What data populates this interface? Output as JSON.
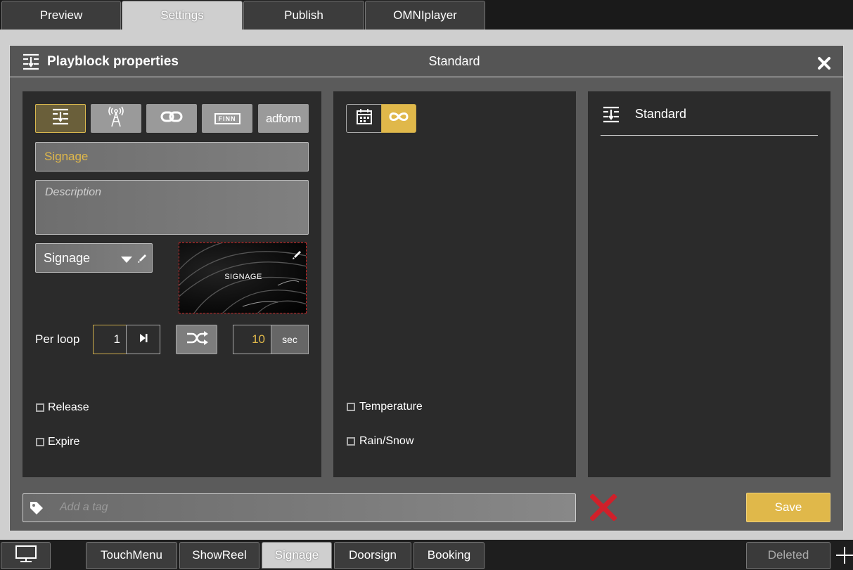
{
  "top_tabs": [
    {
      "label": "Preview",
      "active": false
    },
    {
      "label": "Settings",
      "active": true
    },
    {
      "label": "Publish",
      "active": false
    },
    {
      "label": "OMNIplayer",
      "active": false
    }
  ],
  "dialog": {
    "title": "Playblock properties",
    "subtitle": "Standard",
    "close_icon": "close-icon"
  },
  "left": {
    "type_buttons": [
      {
        "icon": "playlist-icon",
        "active": true
      },
      {
        "icon": "antenna-icon",
        "active": false
      },
      {
        "icon": "link-icon",
        "active": false
      },
      {
        "icon": "finn-logo",
        "label": "FINN",
        "active": false
      },
      {
        "icon": "adform-logo",
        "label": "adform",
        "active": false
      }
    ],
    "name_value": "Signage",
    "description_placeholder": "Description",
    "category_select": "Signage",
    "thumbnail_label": "SIGNAGE",
    "per_loop_label": "Per loop",
    "per_loop_value": "1",
    "duration_value": "10",
    "duration_unit": "sec",
    "release_label": "Release",
    "expire_label": "Expire"
  },
  "middle": {
    "temperature_label": "Temperature",
    "rain_label": "Rain/Snow"
  },
  "right": {
    "item_label": "Standard"
  },
  "footer": {
    "tag_placeholder": "Add a tag",
    "save_label": "Save"
  },
  "bottom_tabs": [
    {
      "label": "TouchMenu",
      "active": false
    },
    {
      "label": "ShowReel",
      "active": false
    },
    {
      "label": "Signage",
      "active": true
    },
    {
      "label": "Doorsign",
      "active": false
    },
    {
      "label": "Booking",
      "active": false
    }
  ],
  "deleted_label": "Deleted",
  "colors": {
    "accent": "#e0b84a",
    "delete": "#d0202a"
  }
}
